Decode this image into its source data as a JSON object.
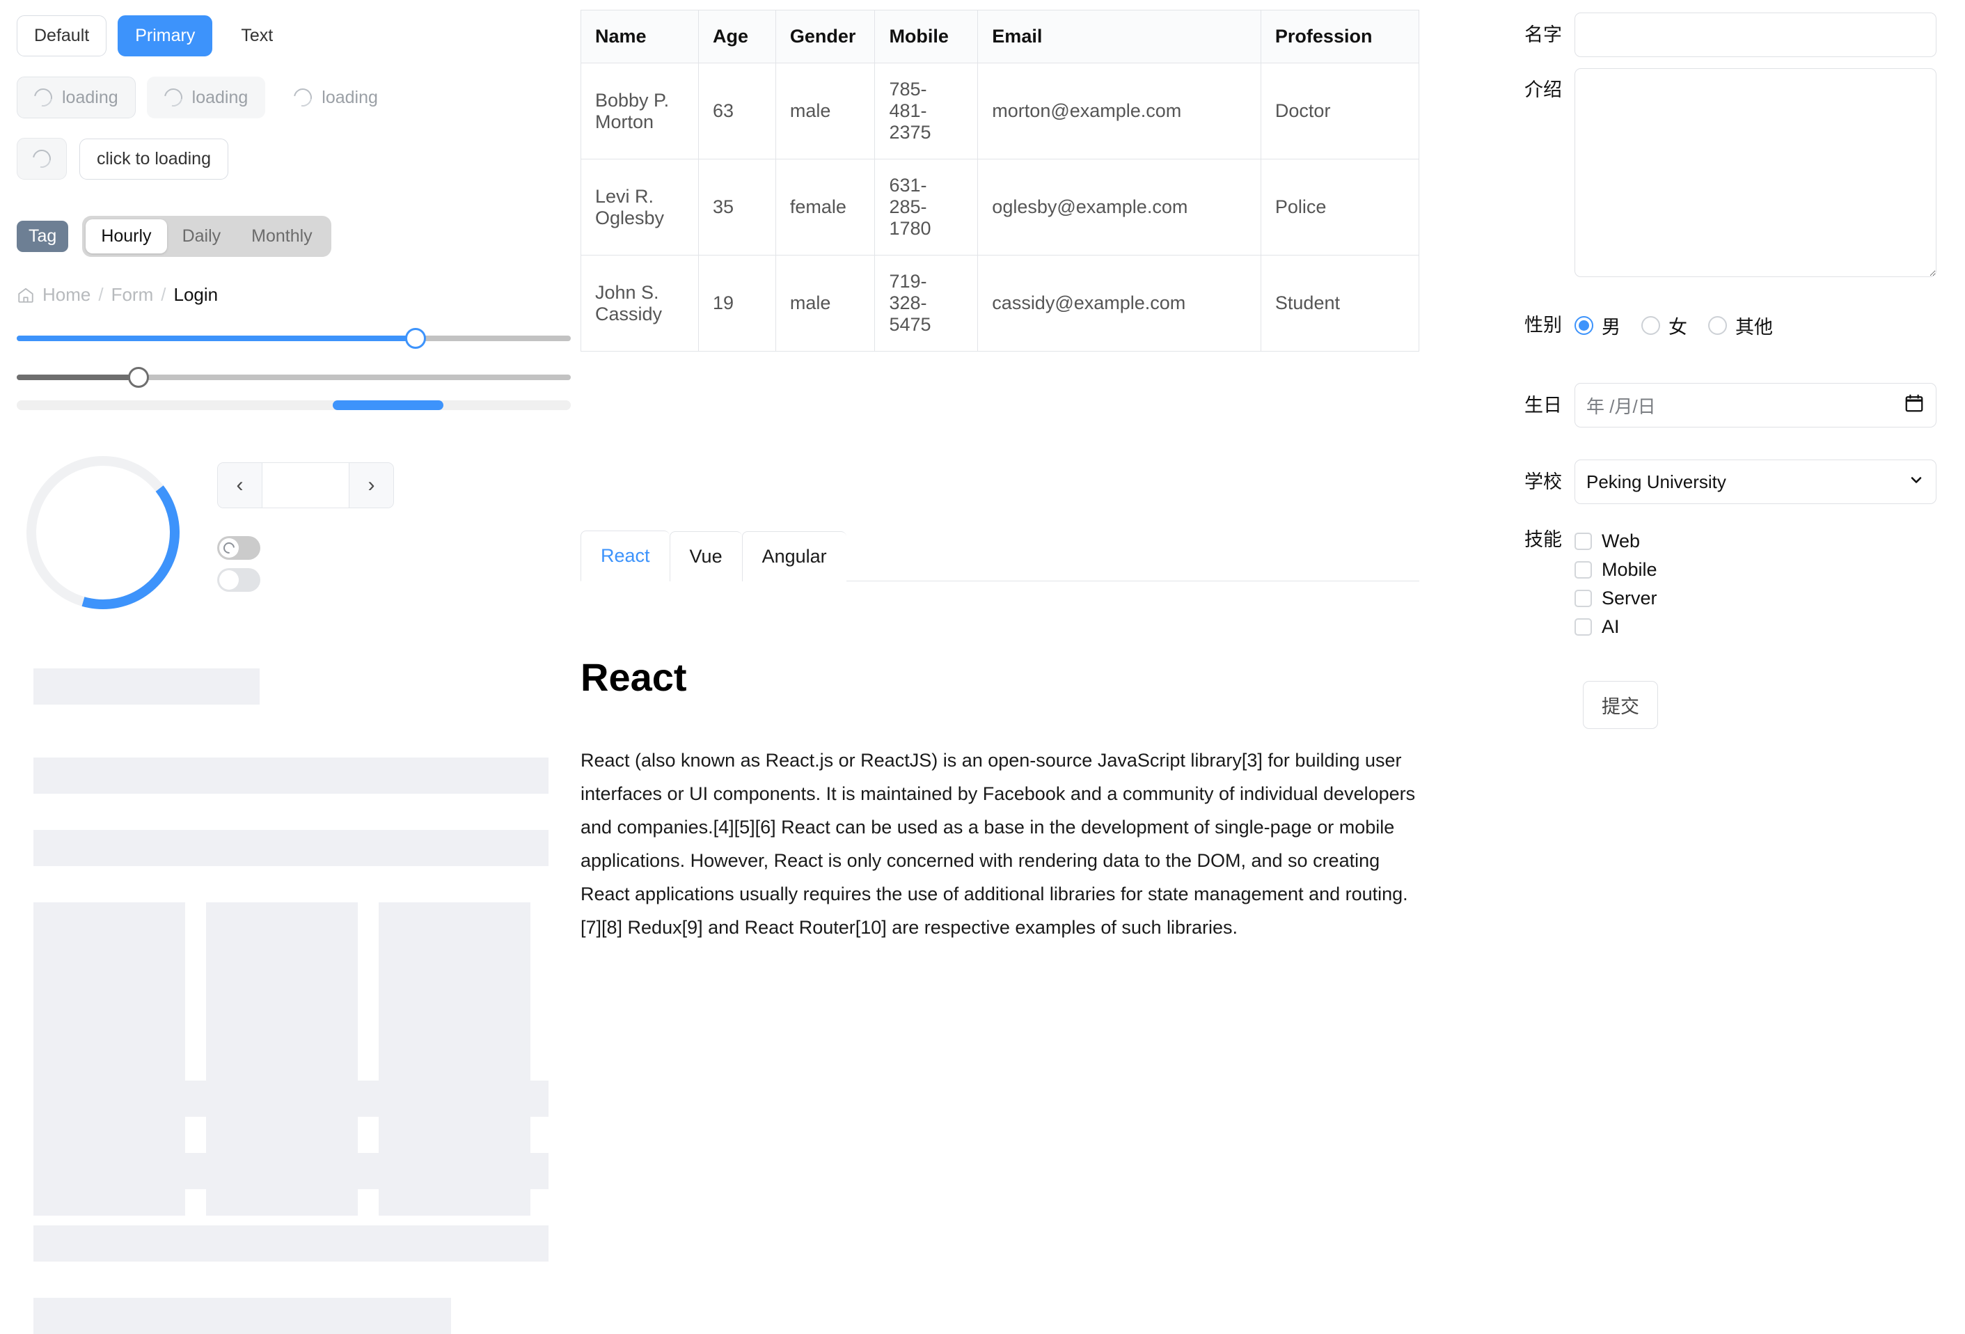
{
  "buttons": {
    "default_label": "Default",
    "primary_label": "Primary",
    "text_label": "Text",
    "loading_outline_label": "loading",
    "loading_plain_label": "loading",
    "loading_bare_label": "loading",
    "click_to_loading_label": "click to loading"
  },
  "tag": {
    "label": "Tag"
  },
  "segmented": {
    "options": [
      "Hourly",
      "Daily",
      "Monthly"
    ],
    "selected": "Hourly"
  },
  "breadcrumb": {
    "home_label": "Home",
    "sep": "/",
    "form_label": "Form",
    "current_label": "Login"
  },
  "sliders": {
    "blue": {
      "value_percent": 72,
      "accent": "#3d93fb"
    },
    "gray": {
      "value_percent": 22,
      "accent": "#6e6e6e"
    }
  },
  "progress_bar": {
    "chunk_start_percent": 57,
    "chunk_width_percent": 20,
    "accent": "#3d93fb"
  },
  "circle_progress": {
    "accent": "#3d93fb",
    "track": "#f0f1f3",
    "arc_percent": 40
  },
  "pager": {
    "prev_icon": "chevron-left-icon",
    "next_icon": "chevron-right-icon",
    "prev_glyph": "‹",
    "next_glyph": "›"
  },
  "toggles": [
    {
      "name": "toggle-loading",
      "state": "off-loading"
    },
    {
      "name": "toggle-plain",
      "state": "off"
    }
  ],
  "table": {
    "columns": [
      "Name",
      "Age",
      "Gender",
      "Mobile",
      "Email",
      "Profession"
    ],
    "rows": [
      {
        "name": "Bobby P. Morton",
        "age": "63",
        "gender": "male",
        "mobile": "785-481-2375",
        "email": "morton@example.com",
        "profession": "Doctor"
      },
      {
        "name": "Levi R. Oglesby",
        "age": "35",
        "gender": "female",
        "mobile": "631-285-1780",
        "email": "oglesby@example.com",
        "profession": "Police"
      },
      {
        "name": "John S. Cassidy",
        "age": "19",
        "gender": "male",
        "mobile": "719-328-5475",
        "email": "cassidy@example.com",
        "profession": "Student"
      }
    ]
  },
  "tabs": {
    "items": [
      "React",
      "Vue",
      "Angular"
    ],
    "active": "React",
    "active_color": "#3d93fb"
  },
  "article": {
    "title": "React",
    "body": "React (also known as React.js or ReactJS) is an open-source JavaScript library[3] for building user interfaces or UI components. It is maintained by Facebook and a community of individual developers and companies.[4][5][6] React can be used as a base in the development of single-page or mobile applications. However, React is only concerned with rendering data to the DOM, and so creating React applications usually requires the use of additional libraries for state management and routing.[7][8] Redux[9] and React Router[10] are respective examples of such libraries."
  },
  "form": {
    "name": {
      "label": "名字",
      "value": "",
      "placeholder": ""
    },
    "intro": {
      "label": "介绍",
      "value": "",
      "placeholder": ""
    },
    "gender": {
      "label": "性别",
      "options": [
        "男",
        "女",
        "其他"
      ],
      "selected": "男"
    },
    "birthday": {
      "label": "生日",
      "value": "",
      "placeholder": "年 /月/日",
      "icon": "calendar-icon"
    },
    "school": {
      "label": "学校",
      "selected": "Peking University",
      "options": [
        "Peking University"
      ],
      "icon": "chevron-down-icon"
    },
    "skills": {
      "label": "技能",
      "options": [
        "Web",
        "Mobile",
        "Server",
        "AI"
      ],
      "checked": []
    },
    "submit_label": "提交"
  }
}
